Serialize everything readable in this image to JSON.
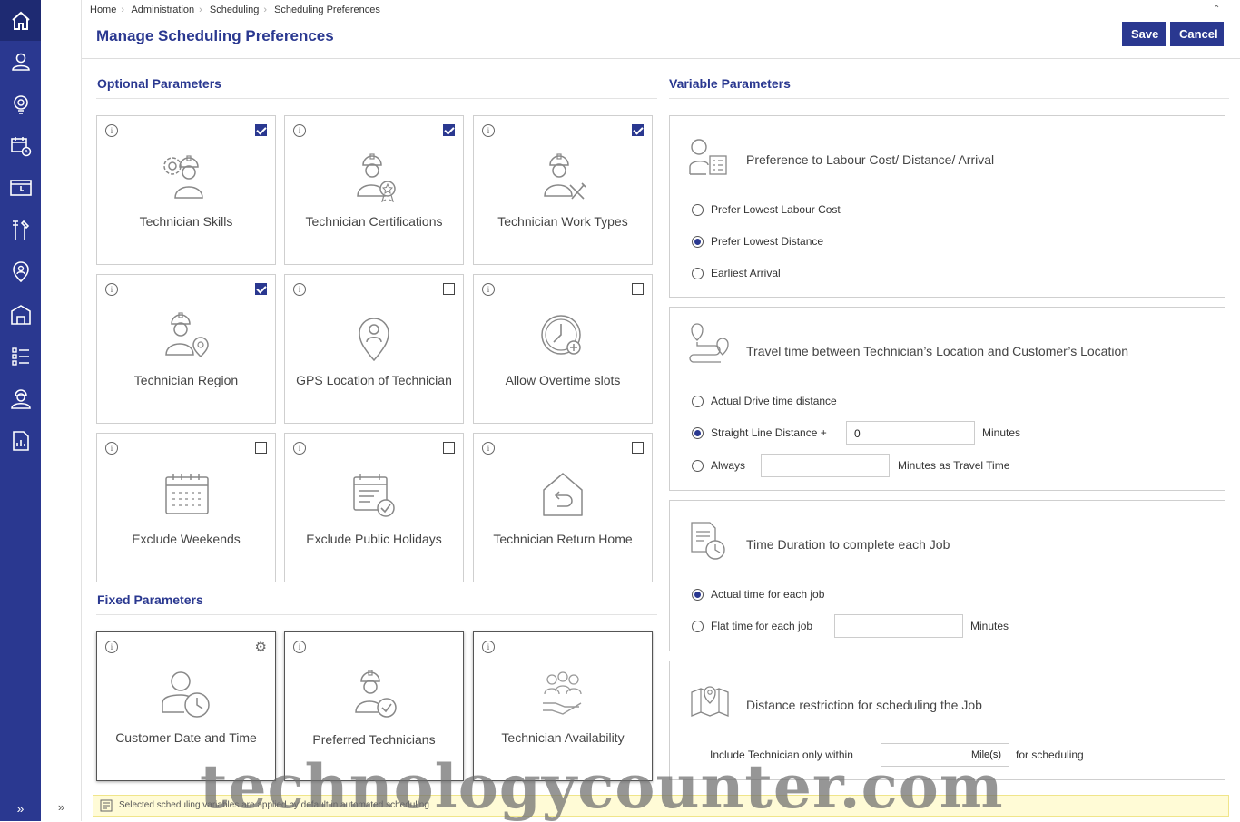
{
  "breadcrumb": [
    "Home",
    "Administration",
    "Scheduling",
    "Scheduling Preferences"
  ],
  "page_title": "Manage Scheduling Preferences",
  "buttons": {
    "save": "Save",
    "cancel": "Cancel"
  },
  "optional": {
    "title": "Optional Parameters",
    "cards": [
      {
        "label": "Technician Skills",
        "checked": true,
        "icon": "technician-skills-icon"
      },
      {
        "label": "Technician Certifications",
        "checked": true,
        "icon": "technician-certifications-icon"
      },
      {
        "label": "Technician Work Types",
        "checked": true,
        "icon": "technician-work-types-icon"
      },
      {
        "label": "Technician Region",
        "checked": true,
        "icon": "technician-region-icon"
      },
      {
        "label": "GPS Location of Technician",
        "checked": false,
        "icon": "gps-location-icon"
      },
      {
        "label": "Allow Overtime slots",
        "checked": false,
        "icon": "overtime-clock-icon"
      },
      {
        "label": "Exclude Weekends",
        "checked": false,
        "icon": "calendar-icon"
      },
      {
        "label": "Exclude Public Holidays",
        "checked": false,
        "icon": "calendar-check-icon"
      },
      {
        "label": "Technician Return Home",
        "checked": false,
        "icon": "return-home-icon"
      }
    ]
  },
  "fixed": {
    "title": "Fixed Parameters",
    "cards": [
      {
        "label": "Customer Date and Time",
        "icon": "customer-clock-icon"
      },
      {
        "label": "Preferred Technicians",
        "icon": "preferred-technician-icon"
      },
      {
        "label": "Technician Availability",
        "icon": "technician-availability-icon"
      }
    ]
  },
  "variable": {
    "title": "Variable Parameters",
    "labour": {
      "title": "Preference to Labour Cost/ Distance/ Arrival",
      "options": [
        "Prefer Lowest Labour Cost",
        "Prefer Lowest Distance",
        "Earliest Arrival"
      ],
      "selected": 1
    },
    "travel": {
      "title": "Travel time between Technician’s Location and Customer’s Location",
      "opt_actual": "Actual Drive time distance",
      "opt_straight": "Straight Line Distance +",
      "straight_value": "0",
      "straight_unit": "Minutes",
      "opt_always": "Always",
      "always_value": "",
      "always_unit": "Minutes as Travel Time",
      "selected": 1
    },
    "duration": {
      "title": "Time Duration to complete each Job",
      "opt_actual": "Actual time for each job",
      "opt_flat": "Flat time for each job",
      "flat_value": "",
      "flat_unit": "Minutes",
      "selected": 0
    },
    "distance": {
      "title": "Distance restriction for scheduling the Job",
      "prefix": "Include Technician only within",
      "unit_inside": "Mile(s)",
      "suffix": "for scheduling"
    }
  },
  "footer_note": "Selected scheduling variables are applied by default in automated scheduling",
  "watermark": "technologycounter.com",
  "colors": {
    "brand": "#2a3890",
    "sidebar": "#2a3890"
  },
  "sidebar_icons": [
    "home-icon",
    "user-icon",
    "bulb-icon",
    "calendar-clock-icon",
    "schedule-icon",
    "tools-icon",
    "location-user-icon",
    "building-icon",
    "list-icon",
    "technician-icon",
    "report-icon"
  ]
}
